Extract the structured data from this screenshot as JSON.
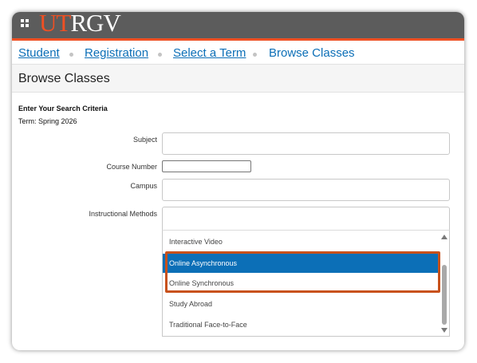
{
  "header": {
    "logo_ut": "UT",
    "logo_rgv": "RGV",
    "menu_icon": "grid-menu-icon",
    "accent_color": "#f05023",
    "bar_color": "#5c5c5c"
  },
  "breadcrumb": {
    "items": [
      {
        "label": "Student",
        "link": true
      },
      {
        "label": "Registration",
        "link": true
      },
      {
        "label": "Select a Term",
        "link": true
      },
      {
        "label": "Browse Classes",
        "link": false
      }
    ],
    "link_color": "#0c6fb7"
  },
  "page": {
    "title": "Browse Classes"
  },
  "form": {
    "heading": "Enter Your Search Criteria",
    "term": "Term: Spring 2026",
    "subject_label": "Subject",
    "course_number_label": "Course Number",
    "campus_label": "Campus",
    "instructional_methods_label": "Instructional Methods"
  },
  "dropdown": {
    "options": [
      "Interactive Video",
      "Online Asynchronous",
      "Online Synchronous",
      "Study Abroad",
      "Traditional Face-to-Face"
    ],
    "selected": "Online Asynchronous",
    "selected_color": "#0c6fb7",
    "highlight_color": "#c8511b"
  }
}
